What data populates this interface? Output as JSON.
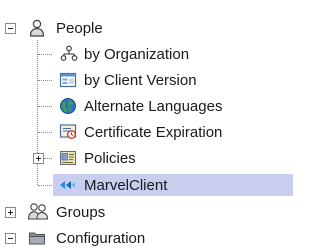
{
  "tree": {
    "people": {
      "label": "People",
      "children": [
        {
          "label": "by Organization",
          "icon": "organization-icon"
        },
        {
          "label": "by Client Version",
          "icon": "client-version-icon"
        },
        {
          "label": "Alternate Languages",
          "icon": "globe-icon"
        },
        {
          "label": "Certificate Expiration",
          "icon": "certificate-icon"
        },
        {
          "label": "Policies",
          "icon": "policies-icon"
        },
        {
          "label": "MarvelClient",
          "icon": "marvelclient-icon"
        }
      ]
    },
    "groups": {
      "label": "Groups"
    },
    "configuration": {
      "label": "Configuration"
    }
  },
  "colors": {
    "selection": "#c9cdf0",
    "connector": "#8c8c8c"
  }
}
